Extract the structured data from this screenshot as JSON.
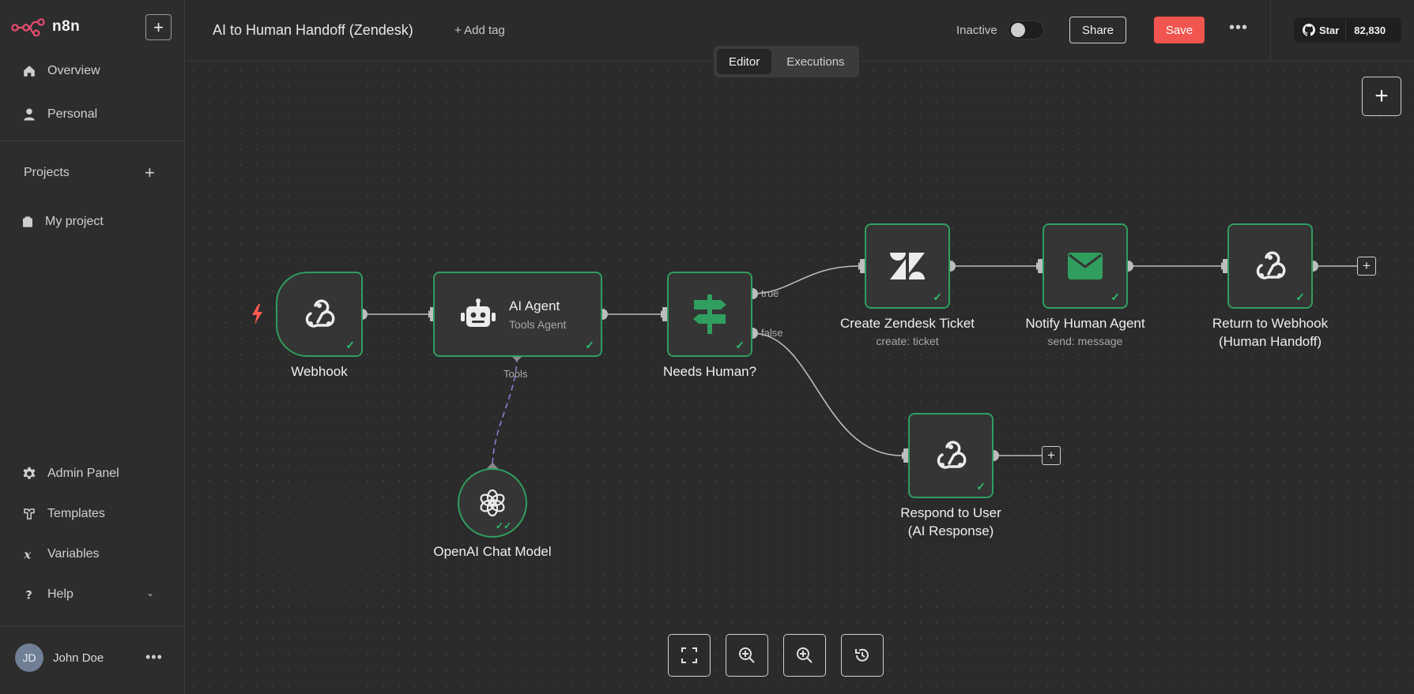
{
  "app": {
    "name": "n8n"
  },
  "sidebar": {
    "items_top": [
      {
        "label": "Overview",
        "icon": "home-icon"
      },
      {
        "label": "Personal",
        "icon": "user-icon"
      }
    ],
    "projects_label": "Projects",
    "projects": [
      {
        "label": "My project",
        "icon": "box-icon"
      }
    ],
    "items_bottom": [
      {
        "label": "Admin Panel",
        "icon": "gear-icon"
      },
      {
        "label": "Templates",
        "icon": "templates-icon"
      },
      {
        "label": "Variables",
        "icon": "variables-icon"
      },
      {
        "label": "Help",
        "icon": "help-icon"
      }
    ],
    "user": {
      "initials": "JD",
      "name": "John Doe"
    }
  },
  "header": {
    "title": "AI to Human Handoff (Zendesk)",
    "add_tag": "+ Add tag",
    "status_label": "Inactive",
    "active": false,
    "share": "Share",
    "save": "Save",
    "github": {
      "star": "Star",
      "count": "82,830"
    }
  },
  "tabs": [
    {
      "label": "Editor",
      "active": true
    },
    {
      "label": "Executions",
      "active": false
    }
  ],
  "nodes": {
    "webhook": {
      "label": "Webhook"
    },
    "ai_agent": {
      "title": "AI Agent",
      "subtitle": "Tools Agent",
      "tools_label": "Tools"
    },
    "openai": {
      "label": "OpenAI Chat Model"
    },
    "needs_human": {
      "label": "Needs Human?",
      "true_label": "true",
      "false_label": "false"
    },
    "zendesk": {
      "label": "Create Zendesk Ticket",
      "sub": "create: ticket"
    },
    "notify": {
      "label": "Notify Human Agent",
      "sub": "send: message"
    },
    "return_webhook": {
      "label_line1": "Return to Webhook",
      "label_line2": "(Human Handoff)"
    },
    "respond_user": {
      "label_line1": "Respond to User",
      "label_line2": "(AI Response)"
    }
  },
  "colors": {
    "accent": "#2f9e5f",
    "save": "#f0554f",
    "brand": "#ea4b71",
    "ai_wire": "#8b7fd6"
  }
}
